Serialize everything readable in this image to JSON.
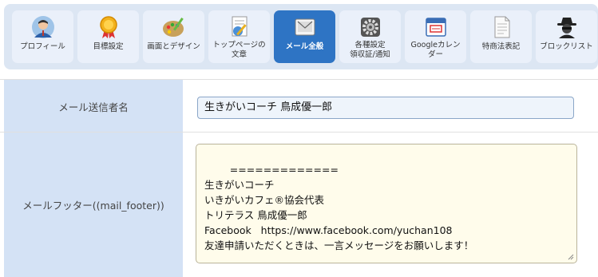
{
  "nav": {
    "tabs": [
      {
        "label": "プロフィール",
        "icon": "profile-avatar-icon"
      },
      {
        "label": "目標設定",
        "icon": "award-medal-icon"
      },
      {
        "label": "画面とデザイン",
        "icon": "paint-palette-icon"
      },
      {
        "label": "トップページの\n文章",
        "icon": "document-pen-icon"
      },
      {
        "label": "メール全般",
        "icon": "mail-icon",
        "active": true
      },
      {
        "label": "各種設定\n領収証/通知",
        "icon": "gear-icon"
      },
      {
        "label": "Googleカレン\nダー",
        "icon": "calendar-icon"
      },
      {
        "label": "特商法表記",
        "icon": "document-icon"
      },
      {
        "label": "ブロックリスト",
        "icon": "spy-icon"
      }
    ]
  },
  "form": {
    "sender": {
      "label": "メール送信者名",
      "value": "生きがいコーチ 鳥成優一郎"
    },
    "footer": {
      "label": "メールフッター((mail_footer))",
      "value": "=============\n生きがいコーチ\nいきがいカフェ®協会代表\nトリテラス 鳥成優一郎\nFacebook   https://www.facebook.com/yuchan108\n友達申請いただくときは、一言メッセージをお願いします！\n\nいきがいカフェ®協会 会員募集中！\n"
    }
  },
  "colors": {
    "nav_bg": "#dce6f3",
    "tab_bg": "#eaf0fa",
    "tab_active": "#2e74c4",
    "label_bg": "#d4e2f5",
    "input_bg": "#eef4fb",
    "textarea_bg": "#fffceb"
  }
}
